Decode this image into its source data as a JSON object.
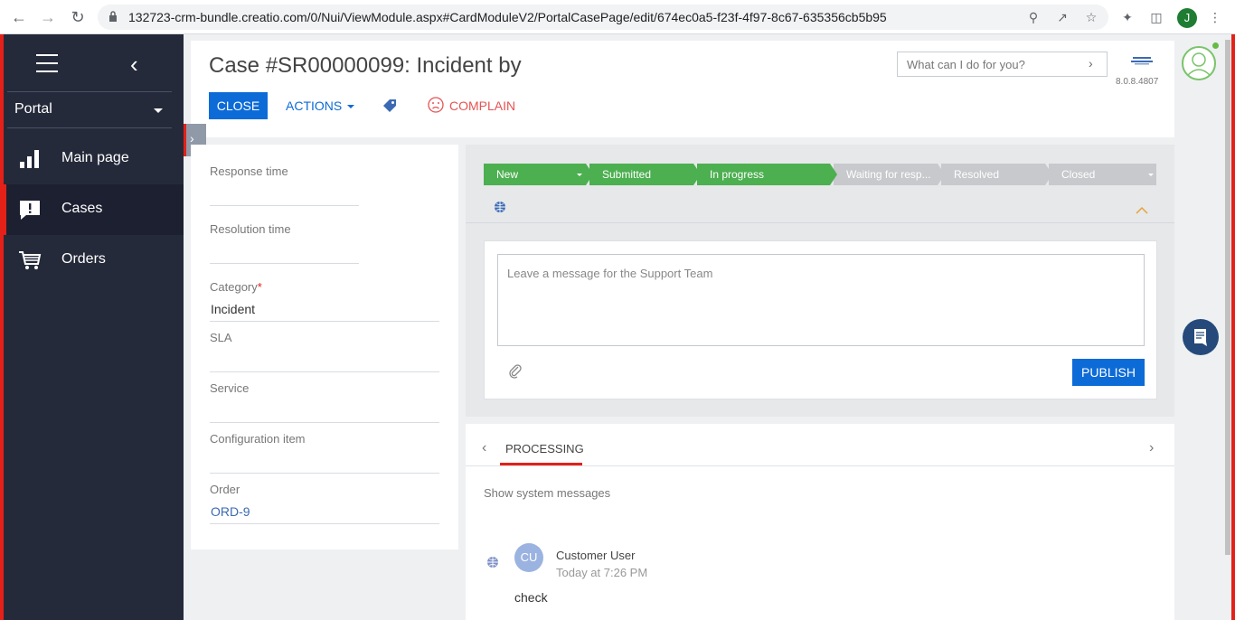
{
  "browser": {
    "url": "132723-crm-bundle.creatio.com/0/Nui/ViewModule.aspx#CardModuleV2/PortalCasePage/edit/674ec0a5-f23f-4f97-8c67-635356cb5b95",
    "profile_initial": "J"
  },
  "sidebar": {
    "workplace": "Portal",
    "items": [
      {
        "label": "Main page",
        "icon": "bar-chart-icon"
      },
      {
        "label": "Cases",
        "icon": "chat-alert-icon"
      },
      {
        "label": "Orders",
        "icon": "cart-icon"
      }
    ]
  },
  "header": {
    "title": "Case #SR00000099: Incident by",
    "close_label": "CLOSE",
    "actions_label": "ACTIONS",
    "complain_label": "COMPLAIN",
    "search_placeholder": "What can I do for you?",
    "version": "8.0.8.4807"
  },
  "form": {
    "fields": [
      {
        "label": "Response time",
        "value": ""
      },
      {
        "label": "Resolution time",
        "value": ""
      },
      {
        "label": "Category",
        "value": "Incident",
        "required": true
      },
      {
        "label": "SLA",
        "value": ""
      },
      {
        "label": "Service",
        "value": ""
      },
      {
        "label": "Configuration item",
        "value": ""
      },
      {
        "label": "Order",
        "value": "ORD-9"
      }
    ]
  },
  "stages": [
    {
      "label": "New",
      "state": "done"
    },
    {
      "label": "Submitted",
      "state": "done"
    },
    {
      "label": "In progress",
      "state": "done"
    },
    {
      "label": "Waiting for resp...",
      "state": "todo"
    },
    {
      "label": "Resolved",
      "state": "todo"
    },
    {
      "label": "Closed",
      "state": "todo"
    }
  ],
  "message": {
    "placeholder": "Leave a message for the Support Team",
    "publish_label": "PUBLISH"
  },
  "feed": {
    "tab_label": "PROCESSING",
    "system_messages_label": "Show system messages",
    "post": {
      "avatar_initials": "CU",
      "author": "Customer User",
      "time": "Today at 7:26 PM",
      "text": "check"
    }
  },
  "colors": {
    "accent_blue": "#0d6bd7",
    "stage_done": "#4caf50",
    "stage_todo": "#c7c9cc",
    "sidebar_bg": "#252a3a",
    "alert_red": "#e32119"
  }
}
